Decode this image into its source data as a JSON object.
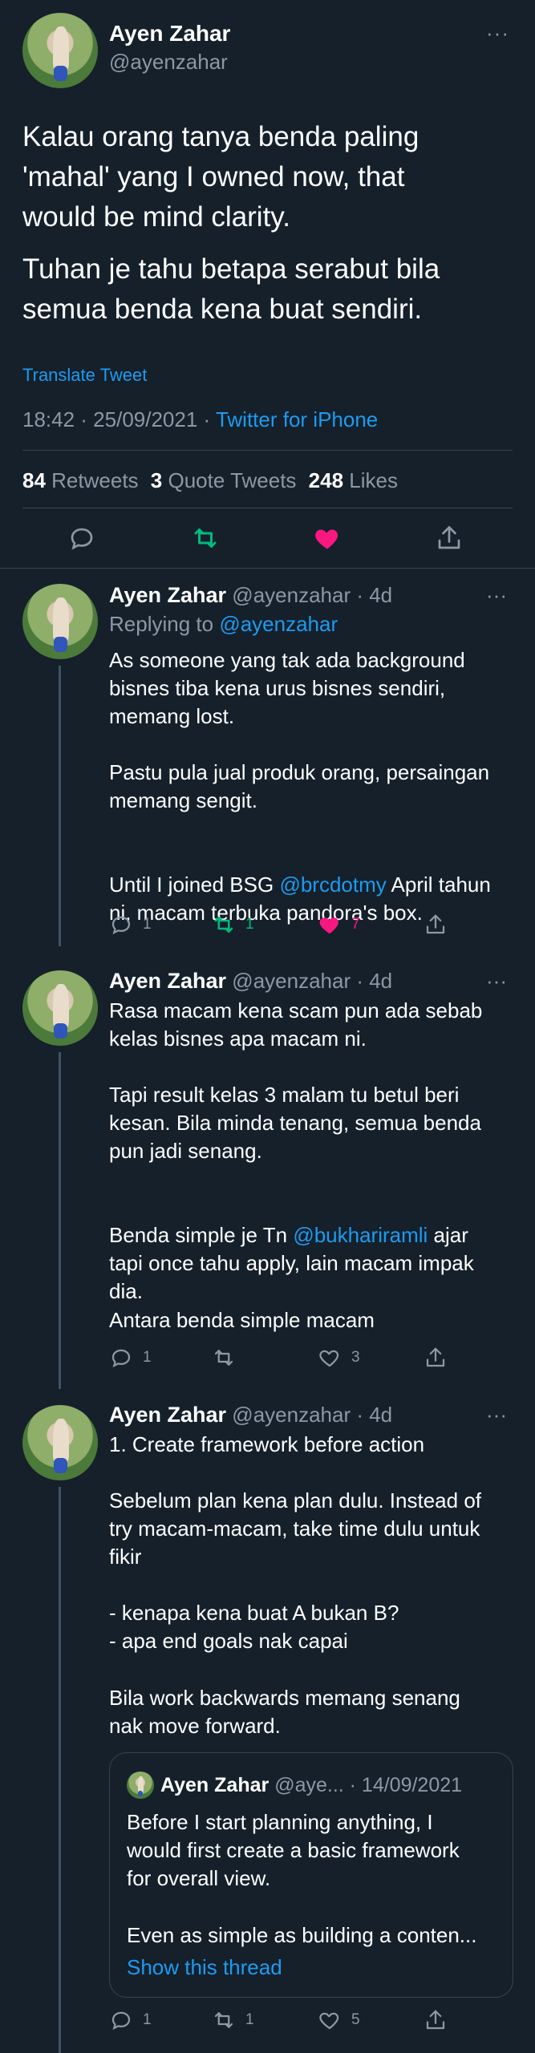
{
  "main_tweet": {
    "name": "Ayen Zahar",
    "handle": "@ayenzahar",
    "more": "···",
    "para1": "Kalau orang tanya benda paling\n'mahal' yang I owned now, that\nwould be mind clarity.",
    "para2": "Tuhan je tahu betapa serabut bila\nsemua benda kena buat sendiri.",
    "translate": "Translate Tweet",
    "time_date": "18:42 · 25/09/2021 · ",
    "source": "Twitter for iPhone",
    "retweets_count": "84",
    "retweets_label": "Retweets",
    "quotes_count": "3",
    "quotes_label": "Quote Tweets",
    "likes_count": "248",
    "likes_label": "Likes"
  },
  "replies": [
    {
      "name": "Ayen Zahar",
      "handle_time": "@ayenzahar · 4d",
      "replying_label": "Replying to ",
      "replying_handle": "@ayenzahar",
      "p1": "As someone yang tak ada background\nbisnes tiba kena urus bisnes sendiri,\nmemang lost.",
      "p2": "Pastu pula jual produk orang, persaingan\nmemang sengit.",
      "p3a": "Until I joined BSG ",
      "p3_mention": "@brcdotmy",
      "p3b": " April tahun",
      "p3c": "ni, macam terbuka pandora's box.",
      "reply_count": "1",
      "retweet_count": "1",
      "like_count": "7"
    },
    {
      "name": "Ayen Zahar",
      "handle_time": "@ayenzahar · 4d",
      "p1": "Rasa macam kena scam pun ada sebab\nkelas bisnes apa macam ni.",
      "p2": "Tapi result kelas 3 malam tu betul beri\nkesan. Bila minda tenang, semua benda\npun jadi senang.",
      "p3a": "Benda simple je Tn ",
      "p3_mention": "@bukhariramli",
      "p3b": " ajar",
      "p3c": "tapi once tahu apply, lain macam impak\ndia.",
      "p4": "Antara benda simple macam",
      "reply_count": "1",
      "like_count": "3"
    },
    {
      "name": "Ayen Zahar",
      "handle_time": "@ayenzahar · 4d",
      "p1": "1. Create framework before action",
      "p2": "Sebelum plan kena plan dulu. Instead of\ntry macam-macam, take time dulu untuk\nfikir",
      "p3": "- kenapa kena buat A bukan B?\n- apa end goals nak capai",
      "p4": "Bila work backwards memang senang\nnak move forward.",
      "quote": {
        "name": "Ayen Zahar",
        "handle_date": "@aye... · 14/09/2021",
        "p1": "Before I start planning anything, I\nwould first create a basic framework\nfor overall view.",
        "p2": "Even as simple as building a conten...",
        "show_thread": "Show this thread"
      },
      "reply_count": "1",
      "retweet_count": "1",
      "like_count": "5"
    }
  ],
  "colors": {
    "background": "#15202b",
    "accent": "#1d9bf0",
    "retweet": "#00ba7c",
    "like": "#f91880",
    "muted": "#8b98a5"
  }
}
